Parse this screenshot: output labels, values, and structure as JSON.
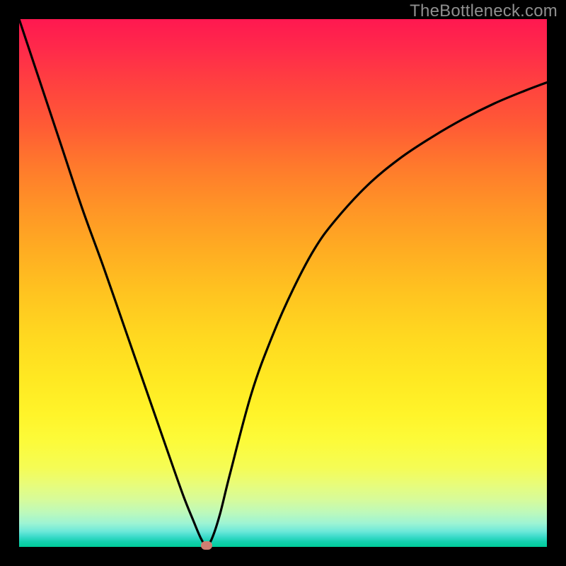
{
  "watermark": "TheBottleneck.com",
  "colors": {
    "background": "#000000",
    "curve": "#000000",
    "marker": "#cf7e72"
  },
  "chart_data": {
    "type": "line",
    "title": "",
    "xlabel": "",
    "ylabel": "",
    "xlim": [
      0,
      100
    ],
    "ylim": [
      0,
      100
    ],
    "grid": false,
    "legend": false,
    "background": "rainbow-vertical-gradient",
    "series": [
      {
        "name": "bottleneck-curve",
        "x": [
          0,
          4,
          8,
          12,
          16,
          20,
          24,
          28,
          31,
          33,
          34.5,
          35.5,
          36.5,
          38,
          40,
          44,
          48,
          52,
          56,
          60,
          66,
          72,
          78,
          84,
          90,
          96,
          100
        ],
        "y": [
          100,
          88,
          76,
          64,
          53,
          41.5,
          30,
          18.5,
          10,
          5,
          1.5,
          0.3,
          1.5,
          6,
          14,
          29,
          40,
          49,
          56.5,
          62,
          68.5,
          73.5,
          77.5,
          81,
          84,
          86.5,
          88
        ]
      }
    ],
    "marker": {
      "x": 35.5,
      "y": 0.3,
      "color": "#cf7e72"
    }
  }
}
